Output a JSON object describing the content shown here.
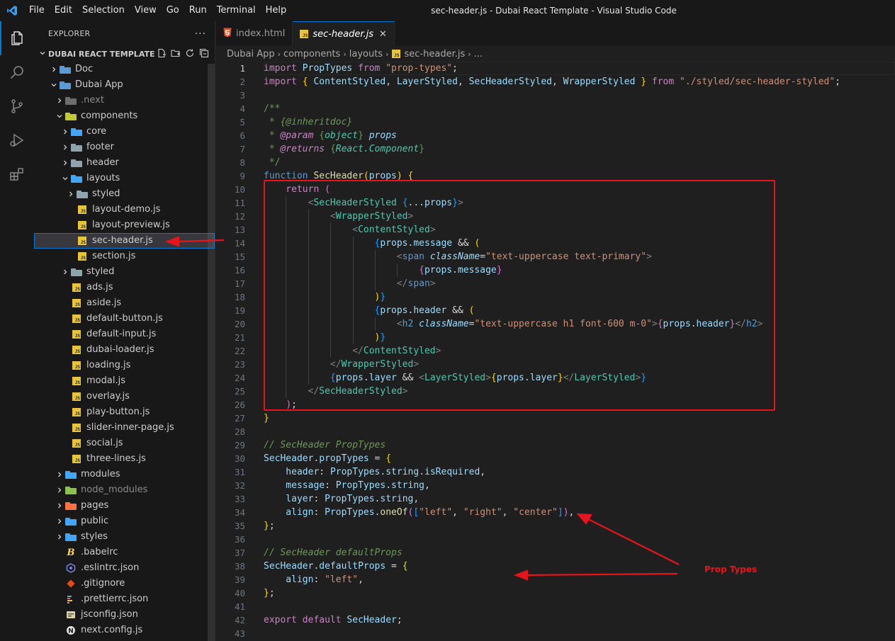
{
  "titlebar": {
    "menu": [
      "File",
      "Edit",
      "Selection",
      "View",
      "Go",
      "Run",
      "Terminal",
      "Help"
    ],
    "window_title": "sec-header.js - Dubai React Template - Visual Studio Code"
  },
  "activitybar": {
    "items": [
      "explorer-icon",
      "search-icon",
      "source-control-icon",
      "run-debug-icon",
      "extensions-icon"
    ]
  },
  "sidebar": {
    "title": "EXPLORER",
    "more": "···",
    "section": "DUBAI REACT TEMPLATE",
    "tree": [
      {
        "label": "Doc",
        "depth": 1,
        "type": "folder",
        "open": false,
        "color": "#5c9ad4"
      },
      {
        "label": "Dubai App",
        "depth": 1,
        "type": "folder",
        "open": true,
        "color": "#5c9ad4"
      },
      {
        "label": ".next",
        "depth": 2,
        "type": "folder",
        "open": false,
        "color": "#6d6d6d",
        "dim": true
      },
      {
        "label": "components",
        "depth": 2,
        "type": "folder",
        "open": true,
        "color": "#c0ca33"
      },
      {
        "label": "core",
        "depth": 3,
        "type": "folder",
        "open": false,
        "color": "#42a5f5"
      },
      {
        "label": "footer",
        "depth": 3,
        "type": "folder",
        "open": false,
        "color": "#90a4ae"
      },
      {
        "label": "header",
        "depth": 3,
        "type": "folder",
        "open": false,
        "color": "#90a4ae"
      },
      {
        "label": "layouts",
        "depth": 3,
        "type": "folder",
        "open": true,
        "color": "#42a5f5"
      },
      {
        "label": "styled",
        "depth": 4,
        "type": "folder",
        "open": false,
        "color": "#90a4ae"
      },
      {
        "label": "layout-demo.js",
        "depth": 4,
        "type": "js"
      },
      {
        "label": "layout-preview.js",
        "depth": 4,
        "type": "js"
      },
      {
        "label": "sec-header.js",
        "depth": 4,
        "type": "js",
        "selected": true
      },
      {
        "label": "section.js",
        "depth": 4,
        "type": "js"
      },
      {
        "label": "styled",
        "depth": 3,
        "type": "folder",
        "open": false,
        "color": "#90a4ae"
      },
      {
        "label": "ads.js",
        "depth": 3,
        "type": "js"
      },
      {
        "label": "aside.js",
        "depth": 3,
        "type": "js"
      },
      {
        "label": "default-button.js",
        "depth": 3,
        "type": "js"
      },
      {
        "label": "default-input.js",
        "depth": 3,
        "type": "js"
      },
      {
        "label": "dubai-loader.js",
        "depth": 3,
        "type": "js"
      },
      {
        "label": "loading.js",
        "depth": 3,
        "type": "js"
      },
      {
        "label": "modal.js",
        "depth": 3,
        "type": "js"
      },
      {
        "label": "overlay.js",
        "depth": 3,
        "type": "js"
      },
      {
        "label": "play-button.js",
        "depth": 3,
        "type": "js"
      },
      {
        "label": "slider-inner-page.js",
        "depth": 3,
        "type": "js"
      },
      {
        "label": "social.js",
        "depth": 3,
        "type": "js"
      },
      {
        "label": "three-lines.js",
        "depth": 3,
        "type": "js"
      },
      {
        "label": "modules",
        "depth": 2,
        "type": "folder",
        "open": false,
        "color": "#42a5f5"
      },
      {
        "label": "node_modules",
        "depth": 2,
        "type": "folder",
        "open": false,
        "color": "#8bc34a",
        "dim": true
      },
      {
        "label": "pages",
        "depth": 2,
        "type": "folder",
        "open": false,
        "color": "#ff7043"
      },
      {
        "label": "public",
        "depth": 2,
        "type": "folder",
        "open": false,
        "color": "#42a5f5"
      },
      {
        "label": "styles",
        "depth": 2,
        "type": "folder",
        "open": false,
        "color": "#42a5f5"
      },
      {
        "label": ".babelrc",
        "depth": 2,
        "type": "babel"
      },
      {
        "label": ".eslintrc.json",
        "depth": 2,
        "type": "eslint"
      },
      {
        "label": ".gitignore",
        "depth": 2,
        "type": "git"
      },
      {
        "label": ".prettierrc.json",
        "depth": 2,
        "type": "prettier"
      },
      {
        "label": "jsconfig.json",
        "depth": 2,
        "type": "jsconfig"
      },
      {
        "label": "next.config.js",
        "depth": 2,
        "type": "next"
      }
    ]
  },
  "tabs": [
    {
      "label": "index.html",
      "icon": "html",
      "active": false
    },
    {
      "label": "sec-header.js",
      "icon": "js",
      "active": true,
      "close": "✕"
    }
  ],
  "breadcrumbs": [
    "Dubai App",
    "components",
    "layouts",
    "sec-header.js",
    "..."
  ],
  "colors": {
    "keyword": "#c586c0",
    "blue_kw": "#569cd6",
    "string": "#ce9178",
    "func": "#dcdcaa",
    "type": "#4ec9b0",
    "var": "#9cdcfe",
    "comment": "#6a9955",
    "plain": "#d4d4d4",
    "tag": "#569cd6",
    "brace1": "#ffd700",
    "brace2": "#da70d6",
    "brace3": "#179fff",
    "annotation": "#e8141c"
  },
  "code": [
    [
      [
        "import ",
        "#c586c0"
      ],
      [
        "PropTypes",
        "#9cdcfe"
      ],
      [
        " from ",
        "#c586c0"
      ],
      [
        "\"prop-types\"",
        "#ce9178"
      ],
      [
        ";",
        "#d4d4d4"
      ]
    ],
    [
      [
        "import ",
        "#c586c0"
      ],
      [
        "{",
        "#ffd700"
      ],
      [
        " ContentStyled",
        "#9cdcfe"
      ],
      [
        ", ",
        "#d4d4d4"
      ],
      [
        "LayerStyled",
        "#9cdcfe"
      ],
      [
        ", ",
        "#d4d4d4"
      ],
      [
        "SecHeaderStyled",
        "#9cdcfe"
      ],
      [
        ", ",
        "#d4d4d4"
      ],
      [
        "WrapperStyled",
        "#9cdcfe"
      ],
      [
        " ",
        "#d4d4d4"
      ],
      [
        "}",
        "#ffd700"
      ],
      [
        " from ",
        "#c586c0"
      ],
      [
        "\"./styled/sec-header-styled\"",
        "#ce9178"
      ],
      [
        ";",
        "#d4d4d4"
      ]
    ],
    [],
    [
      [
        "/**",
        "#6a9955"
      ]
    ],
    [
      [
        " * ",
        "#6a9955"
      ],
      [
        "{@inheritdoc}",
        "#6a9955",
        "i"
      ]
    ],
    [
      [
        " * ",
        "#6a9955"
      ],
      [
        "@param ",
        "#c586c0",
        "i"
      ],
      [
        "{",
        "#6a9955"
      ],
      [
        "object",
        "#4ec9b0",
        "i"
      ],
      [
        "}",
        "#6a9955"
      ],
      [
        " props",
        "#9cdcfe",
        "i"
      ]
    ],
    [
      [
        " * ",
        "#6a9955"
      ],
      [
        "@returns ",
        "#c586c0",
        "i"
      ],
      [
        "{",
        "#6a9955"
      ],
      [
        "React.Component",
        "#4ec9b0",
        "i"
      ],
      [
        "}",
        "#6a9955"
      ]
    ],
    [
      [
        " */",
        "#6a9955"
      ]
    ],
    [
      [
        "function ",
        "#569cd6"
      ],
      [
        "SecHeader",
        "#dcdcaa"
      ],
      [
        "(",
        "#ffd700"
      ],
      [
        "props",
        "#9cdcfe"
      ],
      [
        ")",
        "#ffd700"
      ],
      [
        " ",
        "#d4d4d4"
      ],
      [
        "{",
        "#ffd700"
      ]
    ],
    [
      [
        "    return ",
        "#c586c0"
      ],
      [
        "(",
        "#da70d6"
      ]
    ],
    [
      [
        "        <",
        "#808080"
      ],
      [
        "SecHeaderStyled",
        "#4ec9b0"
      ],
      [
        " ",
        "#d4d4d4"
      ],
      [
        "{",
        "#179fff"
      ],
      [
        "...",
        "#d4d4d4"
      ],
      [
        "props",
        "#9cdcfe"
      ],
      [
        "}",
        "#179fff"
      ],
      [
        ">",
        "#808080"
      ]
    ],
    [
      [
        "            <",
        "#808080"
      ],
      [
        "WrapperStyled",
        "#4ec9b0"
      ],
      [
        ">",
        "#808080"
      ]
    ],
    [
      [
        "                <",
        "#808080"
      ],
      [
        "ContentStyled",
        "#4ec9b0"
      ],
      [
        ">",
        "#808080"
      ]
    ],
    [
      [
        "                    ",
        "#d4d4d4"
      ],
      [
        "{",
        "#179fff"
      ],
      [
        "props",
        "#9cdcfe"
      ],
      [
        ".",
        "#d4d4d4"
      ],
      [
        "message",
        "#9cdcfe"
      ],
      [
        " && ",
        "#d4d4d4"
      ],
      [
        "(",
        "#ffd700"
      ]
    ],
    [
      [
        "                        <",
        "#808080"
      ],
      [
        "span",
        "#569cd6"
      ],
      [
        " ",
        "#d4d4d4"
      ],
      [
        "className",
        "#9cdcfe",
        "i"
      ],
      [
        "=",
        "#d4d4d4"
      ],
      [
        "\"text-uppercase text-primary\"",
        "#ce9178"
      ],
      [
        ">",
        "#808080"
      ]
    ],
    [
      [
        "                            ",
        "#d4d4d4"
      ],
      [
        "{",
        "#da70d6"
      ],
      [
        "props",
        "#9cdcfe"
      ],
      [
        ".",
        "#d4d4d4"
      ],
      [
        "message",
        "#9cdcfe"
      ],
      [
        "}",
        "#da70d6"
      ]
    ],
    [
      [
        "                        </",
        "#808080"
      ],
      [
        "span",
        "#569cd6"
      ],
      [
        ">",
        "#808080"
      ]
    ],
    [
      [
        "                    ",
        "#d4d4d4"
      ],
      [
        ")",
        "#ffd700"
      ],
      [
        "}",
        "#179fff"
      ]
    ],
    [
      [
        "                    ",
        "#d4d4d4"
      ],
      [
        "{",
        "#179fff"
      ],
      [
        "props",
        "#9cdcfe"
      ],
      [
        ".",
        "#d4d4d4"
      ],
      [
        "header",
        "#9cdcfe"
      ],
      [
        " && ",
        "#d4d4d4"
      ],
      [
        "(",
        "#ffd700"
      ]
    ],
    [
      [
        "                        <",
        "#808080"
      ],
      [
        "h2",
        "#569cd6"
      ],
      [
        " ",
        "#d4d4d4"
      ],
      [
        "className",
        "#9cdcfe",
        "i"
      ],
      [
        "=",
        "#d4d4d4"
      ],
      [
        "\"text-uppercase h1 font-600 m-0\"",
        "#ce9178"
      ],
      [
        ">",
        "#808080"
      ],
      [
        "{",
        "#da70d6"
      ],
      [
        "props",
        "#9cdcfe"
      ],
      [
        ".",
        "#d4d4d4"
      ],
      [
        "header",
        "#9cdcfe"
      ],
      [
        "}",
        "#da70d6"
      ],
      [
        "</",
        "#808080"
      ],
      [
        "h2",
        "#569cd6"
      ],
      [
        ">",
        "#808080"
      ]
    ],
    [
      [
        "                    ",
        "#d4d4d4"
      ],
      [
        ")",
        "#ffd700"
      ],
      [
        "}",
        "#179fff"
      ]
    ],
    [
      [
        "                </",
        "#808080"
      ],
      [
        "ContentStyled",
        "#4ec9b0"
      ],
      [
        ">",
        "#808080"
      ]
    ],
    [
      [
        "            </",
        "#808080"
      ],
      [
        "WrapperStyled",
        "#4ec9b0"
      ],
      [
        ">",
        "#808080"
      ]
    ],
    [
      [
        "            ",
        "#d4d4d4"
      ],
      [
        "{",
        "#179fff"
      ],
      [
        "props",
        "#9cdcfe"
      ],
      [
        ".",
        "#d4d4d4"
      ],
      [
        "layer",
        "#9cdcfe"
      ],
      [
        " && ",
        "#d4d4d4"
      ],
      [
        "<",
        "#808080"
      ],
      [
        "LayerStyled",
        "#4ec9b0"
      ],
      [
        ">",
        "#808080"
      ],
      [
        "{",
        "#ffd700"
      ],
      [
        "props",
        "#9cdcfe"
      ],
      [
        ".",
        "#d4d4d4"
      ],
      [
        "layer",
        "#9cdcfe"
      ],
      [
        "}",
        "#ffd700"
      ],
      [
        "</",
        "#808080"
      ],
      [
        "LayerStyled",
        "#4ec9b0"
      ],
      [
        ">",
        "#808080"
      ],
      [
        "}",
        "#179fff"
      ]
    ],
    [
      [
        "        </",
        "#808080"
      ],
      [
        "SecHeaderStyled",
        "#4ec9b0"
      ],
      [
        ">",
        "#808080"
      ]
    ],
    [
      [
        "    ",
        "#d4d4d4"
      ],
      [
        ")",
        "#da70d6"
      ],
      [
        ";",
        "#d4d4d4"
      ]
    ],
    [
      [
        "}",
        "#ffd700"
      ]
    ],
    [],
    [
      [
        "// SecHeader PropTypes",
        "#6a9955",
        "i"
      ]
    ],
    [
      [
        "SecHeader",
        "#9cdcfe"
      ],
      [
        ".",
        "#d4d4d4"
      ],
      [
        "propTypes",
        "#9cdcfe"
      ],
      [
        " = ",
        "#d4d4d4"
      ],
      [
        "{",
        "#ffd700"
      ]
    ],
    [
      [
        "    header",
        "#9cdcfe"
      ],
      [
        ": ",
        "#d4d4d4"
      ],
      [
        "PropTypes",
        "#9cdcfe"
      ],
      [
        ".",
        "#d4d4d4"
      ],
      [
        "string",
        "#9cdcfe"
      ],
      [
        ".",
        "#d4d4d4"
      ],
      [
        "isRequired",
        "#9cdcfe"
      ],
      [
        ",",
        "#d4d4d4"
      ]
    ],
    [
      [
        "    message",
        "#9cdcfe"
      ],
      [
        ": ",
        "#d4d4d4"
      ],
      [
        "PropTypes",
        "#9cdcfe"
      ],
      [
        ".",
        "#d4d4d4"
      ],
      [
        "string",
        "#9cdcfe"
      ],
      [
        ",",
        "#d4d4d4"
      ]
    ],
    [
      [
        "    layer",
        "#9cdcfe"
      ],
      [
        ": ",
        "#d4d4d4"
      ],
      [
        "PropTypes",
        "#9cdcfe"
      ],
      [
        ".",
        "#d4d4d4"
      ],
      [
        "string",
        "#9cdcfe"
      ],
      [
        ",",
        "#d4d4d4"
      ]
    ],
    [
      [
        "    align",
        "#9cdcfe"
      ],
      [
        ": ",
        "#d4d4d4"
      ],
      [
        "PropTypes",
        "#9cdcfe"
      ],
      [
        ".",
        "#d4d4d4"
      ],
      [
        "oneOf",
        "#dcdcaa"
      ],
      [
        "(",
        "#da70d6"
      ],
      [
        "[",
        "#179fff"
      ],
      [
        "\"left\"",
        "#ce9178"
      ],
      [
        ", ",
        "#d4d4d4"
      ],
      [
        "\"right\"",
        "#ce9178"
      ],
      [
        ", ",
        "#d4d4d4"
      ],
      [
        "\"center\"",
        "#ce9178"
      ],
      [
        "]",
        "#179fff"
      ],
      [
        ")",
        "#da70d6"
      ],
      [
        ",",
        "#d4d4d4"
      ]
    ],
    [
      [
        "}",
        "#ffd700"
      ],
      [
        ";",
        "#d4d4d4"
      ]
    ],
    [],
    [
      [
        "// SecHeader defaultProps",
        "#6a9955",
        "i"
      ]
    ],
    [
      [
        "SecHeader",
        "#9cdcfe"
      ],
      [
        ".",
        "#d4d4d4"
      ],
      [
        "defaultProps",
        "#9cdcfe"
      ],
      [
        " = ",
        "#d4d4d4"
      ],
      [
        "{",
        "#ffd700"
      ]
    ],
    [
      [
        "    align",
        "#9cdcfe"
      ],
      [
        ": ",
        "#d4d4d4"
      ],
      [
        "\"left\"",
        "#ce9178"
      ],
      [
        ",",
        "#d4d4d4"
      ]
    ],
    [
      [
        "}",
        "#ffd700"
      ],
      [
        ";",
        "#d4d4d4"
      ]
    ],
    [],
    [
      [
        "export ",
        "#c586c0"
      ],
      [
        "default ",
        "#c586c0"
      ],
      [
        "SecHeader",
        "#9cdcfe"
      ],
      [
        ";",
        "#d4d4d4"
      ]
    ],
    []
  ],
  "line_numbers": [
    "1",
    "2",
    "3",
    "4",
    "5",
    "6",
    "7",
    "8",
    "9",
    "10",
    "11",
    "12",
    "13",
    "14",
    "15",
    "16",
    "17",
    "18",
    "19",
    "20",
    "21",
    "22",
    "23",
    "24",
    "25",
    "26",
    "27",
    "28",
    "29",
    "30",
    "31",
    "32",
    "33",
    "34",
    "35",
    "36",
    "37",
    "38",
    "39",
    "40",
    "41",
    "42",
    "43"
  ],
  "annotation": {
    "label": "Prop Types"
  }
}
